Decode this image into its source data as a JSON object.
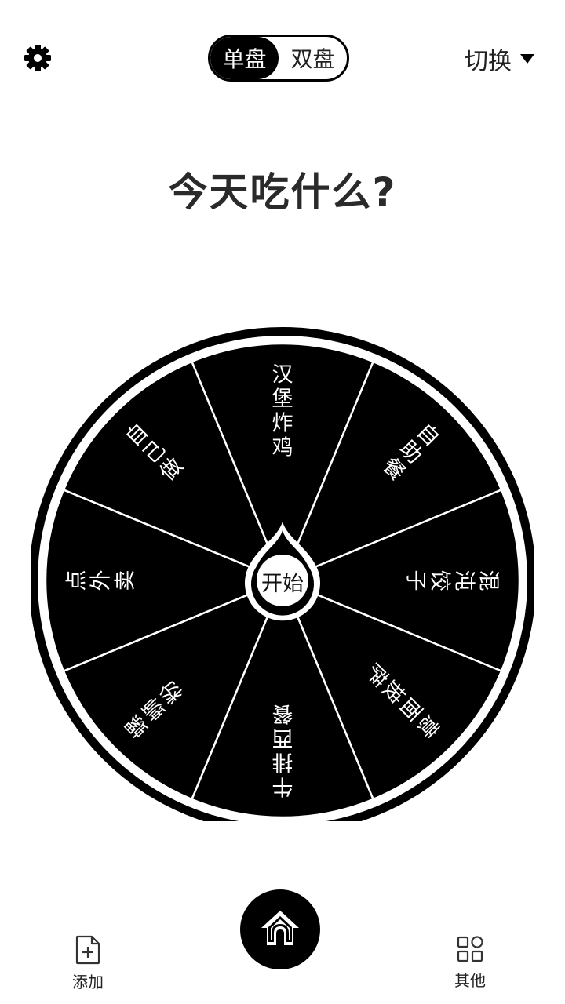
{
  "header": {
    "settings_icon": "gear-icon",
    "mode_toggle": {
      "options": [
        "单盘",
        "双盘"
      ],
      "selected": "单盘"
    },
    "switch_label": "切换",
    "switch_icon": "caret-down-icon"
  },
  "title": "今天吃什么?",
  "wheel": {
    "segments": [
      "汉堡炸鸡",
      "自助餐",
      "混沌饺子",
      "意面披萨",
      "牛排西餐",
      "螺蛳粉",
      "点外卖",
      "自己做"
    ],
    "segment_color": "#000000",
    "text_color": "#ffffff",
    "start_label": "开始"
  },
  "bottom_nav": {
    "add_label": "添加",
    "add_icon": "add-file-icon",
    "home_icon": "home-icon",
    "other_label": "其他",
    "other_icon": "grid-icon"
  }
}
